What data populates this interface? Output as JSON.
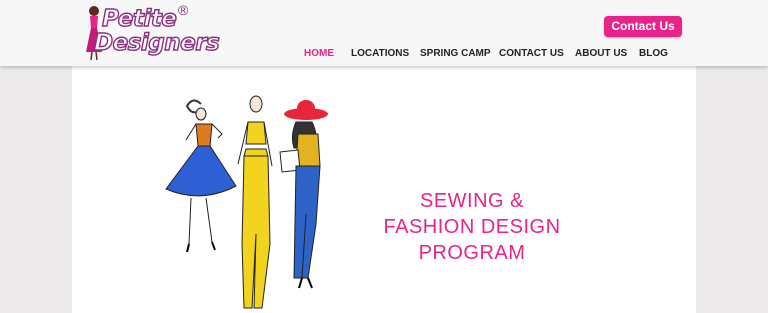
{
  "logo": {
    "line1": "Petite",
    "line2": "Designers",
    "registered": "®"
  },
  "header": {
    "contact_button": "Contact Us"
  },
  "nav": {
    "items": [
      {
        "label": "HOME"
      },
      {
        "label": "LOCATIONS"
      },
      {
        "label": "SPRING CAMP"
      },
      {
        "label": "CONTACT US"
      },
      {
        "label": "ABOUT US"
      },
      {
        "label": "BLOG"
      }
    ]
  },
  "hero": {
    "headline_line1": "SEWING &",
    "headline_line2": "FASHION DESIGN",
    "headline_line3": "PROGRAM"
  },
  "colors": {
    "accent": "#e8238a",
    "logo_outline": "#8a2f7e",
    "background": "#ebe9ea"
  },
  "icons": {
    "hero_image": "fashion-sketch-illustration"
  }
}
